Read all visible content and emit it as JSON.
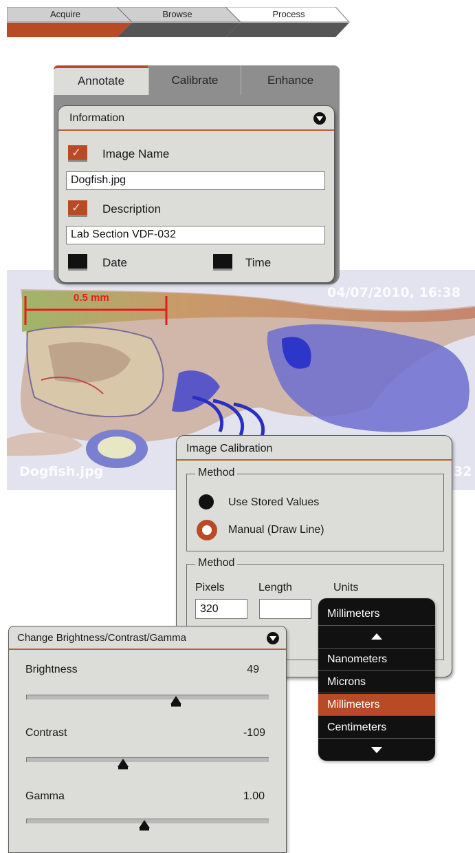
{
  "workflow": {
    "steps": [
      "Acquire",
      "Browse",
      "Process"
    ],
    "active_index": 2
  },
  "annotate_panel": {
    "tabs": [
      "Annotate",
      "Calibrate",
      "Enhance"
    ],
    "active_tab": "Annotate",
    "section_title": "Information",
    "image_name": {
      "label": "Image Name",
      "checked": true,
      "value": "Dogfish.jpg"
    },
    "description": {
      "label": "Description",
      "checked": true,
      "value": "Lab Section VDF-032"
    },
    "date": {
      "label": "Date",
      "checked": false
    },
    "time": {
      "label": "Time",
      "checked": false
    },
    "check_mark": "✓"
  },
  "specimen": {
    "scale_label": "0.5 mm",
    "timestamp": "04/07/2010, 16:38",
    "filename_overlay": "Dogfish.jpg",
    "right_overlay_partial": "32"
  },
  "calibration_panel": {
    "title": "Image Calibration",
    "method_group_1": {
      "legend": "Method",
      "options": [
        {
          "label": "Use Stored Values",
          "selected": false
        },
        {
          "label": "Manual (Draw Line)",
          "selected": true
        }
      ]
    },
    "method_group_2": {
      "legend": "Method",
      "pixels_label": "Pixels",
      "pixels_value": "320",
      "length_label": "Length",
      "length_value": "",
      "units_label": "Units"
    }
  },
  "units_dropdown": {
    "selected": "Millimeters",
    "options": [
      "Nanometers",
      "Microns",
      "Millimeters",
      "Centimeters"
    ]
  },
  "bcg_panel": {
    "title": "Change Brightness/Contrast/Gamma",
    "brightness": {
      "label": "Brightness",
      "value": "49",
      "level": 0.62
    },
    "contrast": {
      "label": "Contrast",
      "value": "-109",
      "level": 0.4
    },
    "gamma": {
      "label": "Gamma",
      "value": "1.00",
      "level": 0.49
    }
  },
  "colors": {
    "accent": "#b94a26",
    "panel_bg": "#dcdcd8",
    "tab_inactive": "#8e8e8e",
    "dropdown_bg": "#111111"
  }
}
